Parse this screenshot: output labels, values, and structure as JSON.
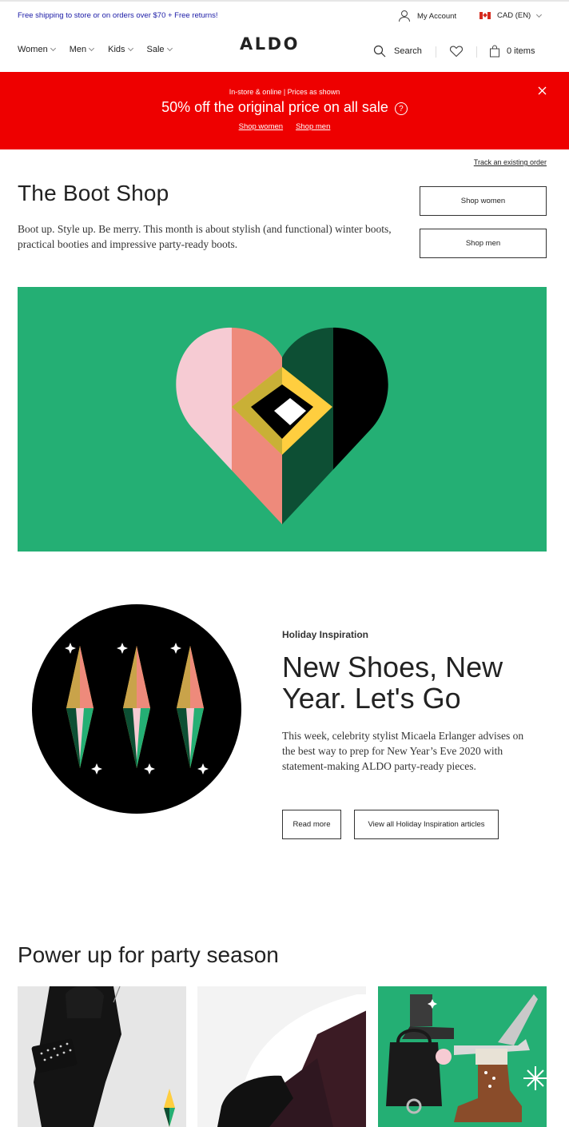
{
  "promo_bar": {
    "message": "Free shipping to store or on orders over $70 + Free returns!",
    "account_label": "My Account",
    "locale_label": "CAD (EN)"
  },
  "nav": {
    "items": [
      {
        "label": "Women"
      },
      {
        "label": "Men"
      },
      {
        "label": "Kids"
      },
      {
        "label": "Sale"
      }
    ],
    "logo": "ALDO",
    "search_label": "Search",
    "cart_label": "0 items"
  },
  "banner": {
    "subtitle": "In-store & online | Prices as shown",
    "headline": "50% off the original price on all sale",
    "help_glyph": "?",
    "link_women": "Shop women",
    "link_men": "Shop men",
    "background": "#ee0000"
  },
  "track_order": "Track an existing order",
  "boot_shop": {
    "title": "The Boot Shop",
    "description": "Boot up. Style up. Be merry. This month is about stylish (and functional) winter boots, practical booties and impressive party-ready boots.",
    "shop_women": "Shop women",
    "shop_men": "Shop men",
    "hero_background": "#24af74"
  },
  "article": {
    "eyebrow": "Holiday Inspiration",
    "title": "New Shoes, New Year. Let's Go",
    "description": "This week, celebrity stylist Micaela Erlanger advises on the best way to prep for New Year’s Eve 2020 with statement-making ALDO party-ready pieces.",
    "read_more": "Read more",
    "view_all": "View all Holiday Inspiration articles"
  },
  "party": {
    "title": "Power up for party season"
  }
}
